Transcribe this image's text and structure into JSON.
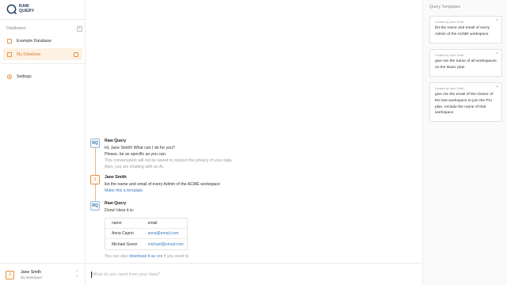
{
  "sidebar": {
    "logo_line1": "RAW",
    "logo_line2": "QUERY",
    "section_label": "Databases",
    "add_label": "+",
    "items": [
      {
        "label": "Example Database"
      },
      {
        "label": "My Database"
      },
      {
        "label": "Settings"
      }
    ],
    "user": {
      "initial": "J",
      "name": "Jane Smith",
      "workspace": "My Workspace"
    }
  },
  "chat": {
    "messages": [
      {
        "avatar": "RQ",
        "author": "Raw Query",
        "lines": [
          "Hi, Jane Smith! What can I do for you?",
          "Please, be as specific as you can."
        ],
        "muted_lines": [
          "This conversation will not be saved to respect the privacy of your data.",
          "Also, you are chatting with an AI."
        ]
      },
      {
        "avatar": "J",
        "author": "Jane Smith",
        "text": "list the name and email of every Admin of the ACME workspace",
        "action": "Make this a template"
      },
      {
        "avatar": "RQ",
        "author": "Raw Query",
        "text": "Done! Here it is:",
        "table": {
          "headers": [
            "name",
            "email"
          ],
          "rows": [
            [
              "Anna Caprio",
              "anna@email.com"
            ],
            [
              "Michael Green",
              "michael@email.com"
            ]
          ]
        },
        "footer_before": "You can also ",
        "footer_link": "download it as csv",
        "footer_after": " if you need to."
      }
    ],
    "input_placeholder": "What do you need from your data?"
  },
  "templates": {
    "title": "Query Templates",
    "cards": [
      {
        "by": "Created by Jane Smith",
        "text": "list the name and email of every Admin of the ACME workspace"
      },
      {
        "by": "Created by Jane Smith",
        "text": "give me the name of all workspaces on the Basic plan"
      },
      {
        "by": "Created by Jane Smith",
        "text": "give me the email of the Owner of the last workspace to join the Pro plan. Include the name of that workspace"
      }
    ],
    "close_label": "×"
  },
  "colors": {
    "accent": "#e2954a",
    "link": "#3d7cc4",
    "bot": "#3c6ea0"
  }
}
